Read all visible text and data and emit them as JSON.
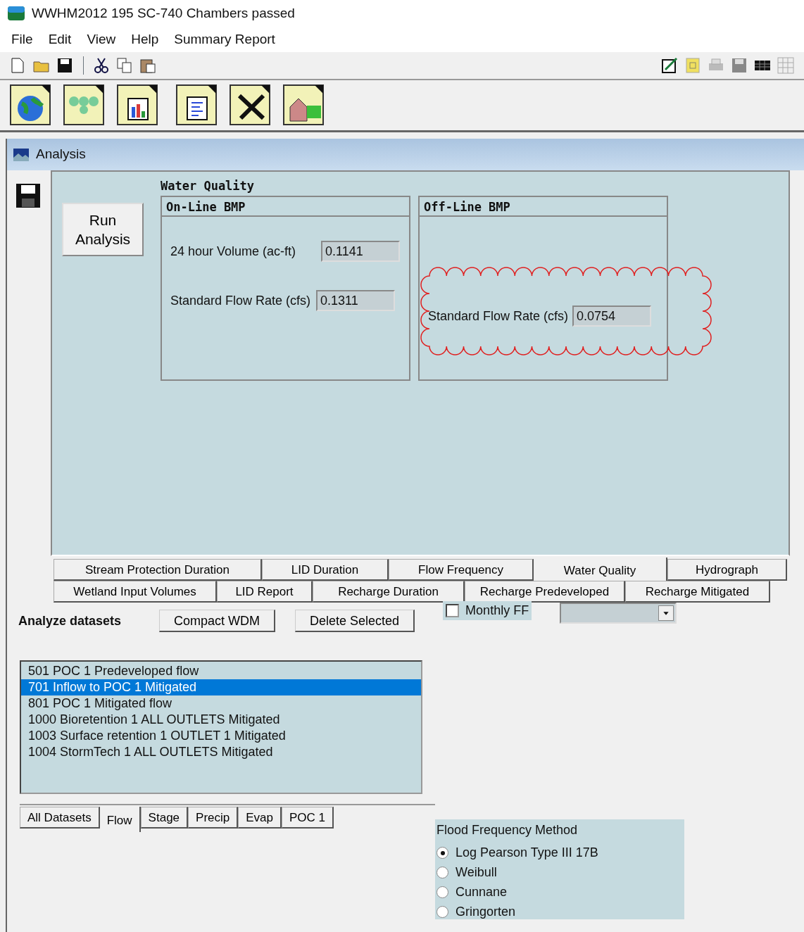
{
  "window": {
    "title": "WWHM2012   195 SC-740 Chambers passed"
  },
  "menu": [
    "File",
    "Edit",
    "View",
    "Help",
    "Summary Report"
  ],
  "analysis_window": {
    "title": "Analysis"
  },
  "run_button": "Run Analysis",
  "water_quality": {
    "title": "Water Quality",
    "online": {
      "title": "On-Line BMP",
      "fields": [
        {
          "label": "24 hour Volume (ac-ft)",
          "value": "0.1141"
        },
        {
          "label": "Standard Flow Rate  (cfs)",
          "value": "0.1311"
        }
      ]
    },
    "offline": {
      "title": "Off-Line BMP",
      "fields": [
        {
          "label": "Standard Flow Rate  (cfs)",
          "value": "0.0754"
        }
      ]
    }
  },
  "result_tabs": [
    [
      {
        "label": "Stream Protection Duration",
        "selected": false
      },
      {
        "label": "LID Duration",
        "selected": false
      },
      {
        "label": "Flow Frequency",
        "selected": false
      },
      {
        "label": "Water Quality",
        "selected": true
      },
      {
        "label": "Hydrograph",
        "selected": false
      }
    ],
    [
      {
        "label": "Wetland Input Volumes",
        "selected": false
      },
      {
        "label": "LID Report",
        "selected": false
      },
      {
        "label": "Recharge Duration",
        "selected": false
      },
      {
        "label": "Recharge Predeveloped",
        "selected": false
      },
      {
        "label": "Recharge Mitigated",
        "selected": false
      }
    ]
  ],
  "analyze_datasets": {
    "label": "Analyze datasets",
    "buttons": [
      "Compact WDM",
      "Delete Selected"
    ],
    "monthly_ff": {
      "label": "Monthly FF",
      "checked": false
    }
  },
  "datasets": [
    {
      "text": "501 POC 1 Predeveloped flow",
      "selected": false
    },
    {
      "text": "701 Inflow to POC 1 Mitigated",
      "selected": true
    },
    {
      "text": "801 POC 1 Mitigated flow",
      "selected": false
    },
    {
      "text": "1000 Bioretention  1 ALL OUTLETS Mitigated",
      "selected": false
    },
    {
      "text": "1003 Surface retention  1 OUTLET 1 Mitigated",
      "selected": false
    },
    {
      "text": "1004 StormTech  1 ALL OUTLETS Mitigated",
      "selected": false
    }
  ],
  "dataset_tabs": [
    {
      "label": "All Datasets",
      "selected": false
    },
    {
      "label": "Flow",
      "selected": true
    },
    {
      "label": "Stage",
      "selected": false
    },
    {
      "label": "Precip",
      "selected": false
    },
    {
      "label": "Evap",
      "selected": false
    },
    {
      "label": "POC 1",
      "selected": false
    }
  ],
  "flood_frequency": {
    "title": "Flood Frequency Method",
    "options": [
      {
        "label": "Log Pearson Type III 17B",
        "selected": true
      },
      {
        "label": "Weibull",
        "selected": false
      },
      {
        "label": "Cunnane",
        "selected": false
      },
      {
        "label": "Gringorten",
        "selected": false
      }
    ]
  }
}
